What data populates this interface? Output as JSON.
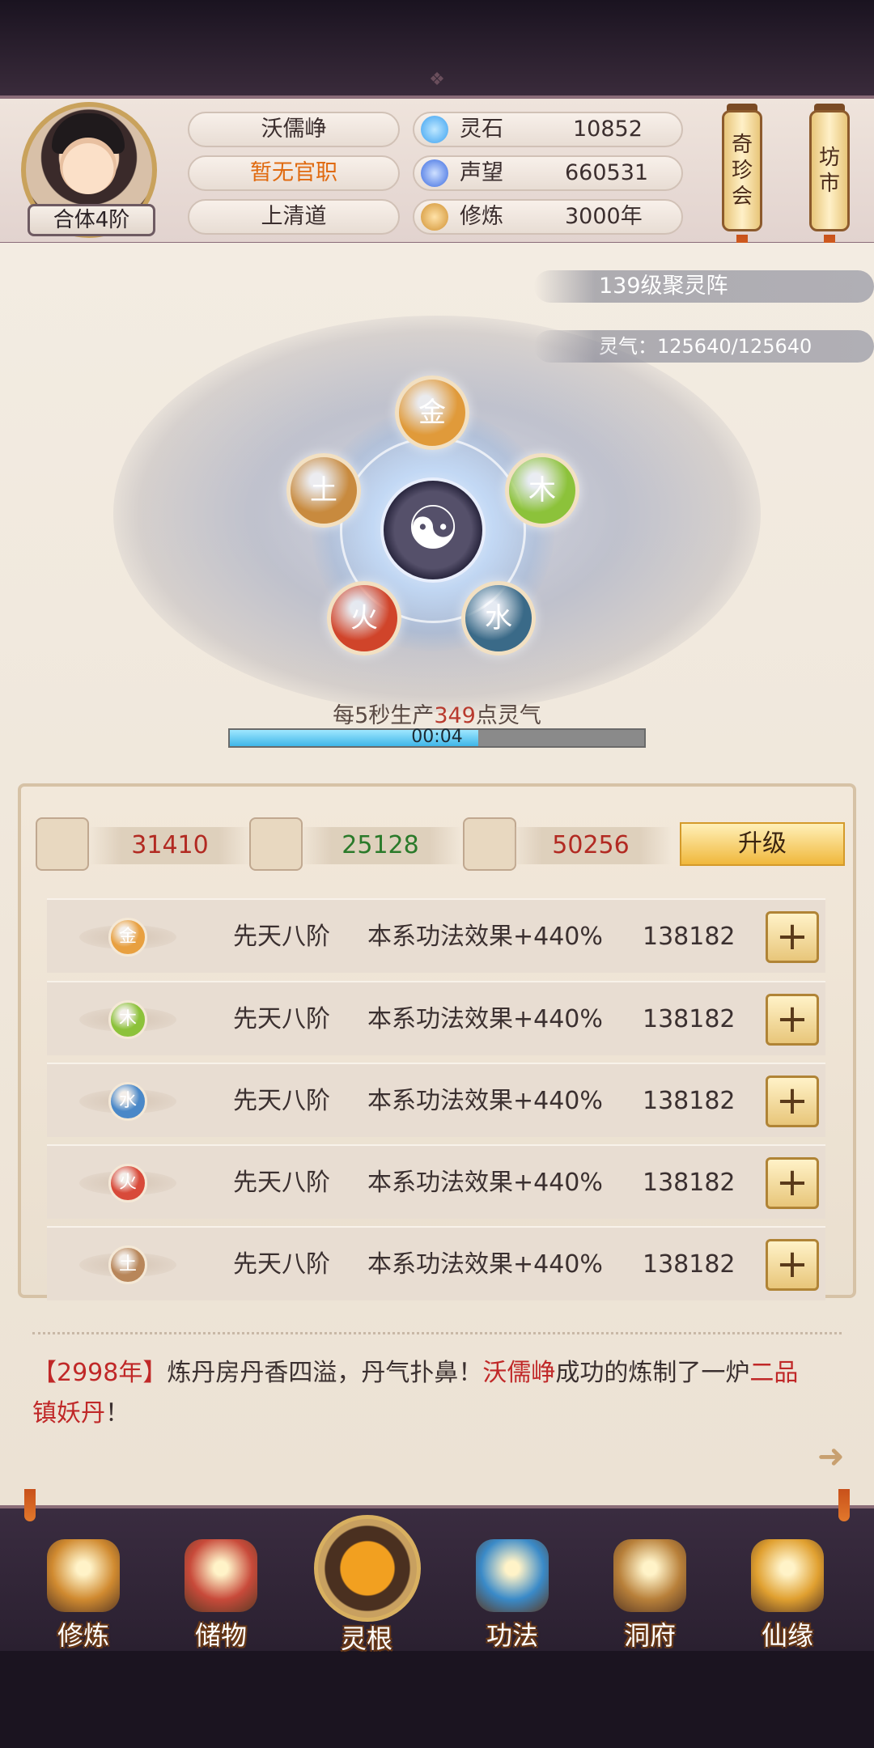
{
  "player": {
    "name": "沃儒峥",
    "official_rank": "暂无官职",
    "sect": "上清道",
    "realm": "合体4阶"
  },
  "stats": [
    {
      "label": "灵石",
      "value": "10852",
      "icon": "spirit-stone-icon",
      "color": "#3aa0f0"
    },
    {
      "label": "声望",
      "value": "660531",
      "icon": "reputation-flame-icon",
      "color": "#3a6ae0"
    },
    {
      "label": "修炼",
      "value": "3000年",
      "icon": "meditation-icon",
      "color": "#d09030"
    }
  ],
  "side_buttons": [
    {
      "label": "奇\n珍\n会"
    },
    {
      "label": "坊\n市"
    }
  ],
  "array": {
    "level_text": "139级聚灵阵",
    "qi_text": "灵气：125640/125640",
    "elements": [
      {
        "label": "金",
        "color": "#e09a3a"
      },
      {
        "label": "木",
        "color": "#8cc23a"
      },
      {
        "label": "水",
        "color": "#3a6a88"
      },
      {
        "label": "火",
        "color": "#d0442a"
      },
      {
        "label": "土",
        "color": "#c88a3e"
      }
    ],
    "center_symbol": "☯",
    "produce_prefix": "每5秒生产",
    "produce_amount": "349",
    "produce_suffix": "点灵气",
    "timer": "00:04",
    "progress": 0.6
  },
  "resources": [
    {
      "icon": "ore-icon",
      "value": "31410",
      "color": "#b22a22"
    },
    {
      "icon": "wood-icon",
      "value": "25128",
      "color": "#2a7a2a"
    },
    {
      "icon": "herb-icon",
      "value": "50256",
      "color": "#b22a22"
    }
  ],
  "upgrade_label": "升级",
  "roots": [
    {
      "element": "金",
      "color": "#e8a040",
      "rank": "先天八阶",
      "effect": "本系功法效果+440%",
      "cost": "138182"
    },
    {
      "element": "木",
      "color": "#8cc23a",
      "rank": "先天八阶",
      "effect": "本系功法效果+440%",
      "cost": "138182"
    },
    {
      "element": "水",
      "color": "#4a88c8",
      "rank": "先天八阶",
      "effect": "本系功法效果+440%",
      "cost": "138182"
    },
    {
      "element": "火",
      "color": "#d84a3a",
      "rank": "先天八阶",
      "effect": "本系功法效果+440%",
      "cost": "138182"
    },
    {
      "element": "土",
      "color": "#b8865a",
      "rank": "先天八阶",
      "effect": "本系功法效果+440%",
      "cost": "138182"
    }
  ],
  "plus_label": "+",
  "message": {
    "open_bracket": "【",
    "year": "2998年",
    "close_bracket": "】",
    "text1": "炼丹房丹香四溢，丹气扑鼻！",
    "actor": "沃儒峥",
    "text2": "成功的炼制了一炉",
    "item_line1": "二品",
    "item_line2": "镇妖丹",
    "end": "！"
  },
  "nav": [
    {
      "label": "修炼",
      "icon": "cultivate-icon",
      "color": "#d08a30"
    },
    {
      "label": "储物",
      "icon": "storage-bag-icon",
      "color": "#c84a3a"
    },
    {
      "label": "灵根",
      "icon": "spirit-root-icon",
      "color": "#f0a020"
    },
    {
      "label": "功法",
      "icon": "technique-book-icon",
      "color": "#3a8ac8"
    },
    {
      "label": "洞府",
      "icon": "cave-abode-icon",
      "color": "#b8803a"
    },
    {
      "label": "仙缘",
      "icon": "immortal-fate-icon",
      "color": "#e0a030"
    }
  ]
}
